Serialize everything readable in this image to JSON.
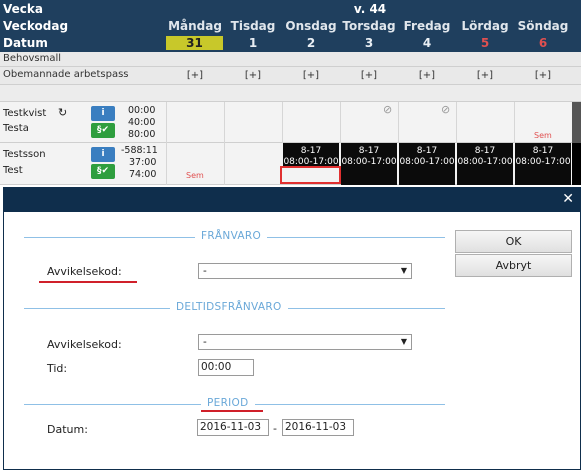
{
  "header": {
    "vecka_label": "Vecka",
    "week": "v. 44",
    "veckodag_label": "Veckodag",
    "datum_label": "Datum",
    "days": [
      {
        "name": "Måndag",
        "num": "31"
      },
      {
        "name": "Tisdag",
        "num": "1"
      },
      {
        "name": "Onsdag",
        "num": "2"
      },
      {
        "name": "Torsdag",
        "num": "3"
      },
      {
        "name": "Fredag",
        "num": "4"
      },
      {
        "name": "Lördag",
        "num": "5"
      },
      {
        "name": "Söndag",
        "num": "6"
      }
    ]
  },
  "rows": {
    "behovsmall": "Behovsmall",
    "obemannade": "Obemannade arbetspass",
    "plus": "[+]"
  },
  "employees": [
    {
      "name1": "Testkvist",
      "name2": "Testa",
      "hrs": [
        "00:00",
        "40:00",
        "80:00"
      ],
      "info": "i",
      "para": "§✔"
    },
    {
      "name1": "Testsson",
      "name2": "Test",
      "hrs": [
        "-588:11",
        "37:00",
        "74:00"
      ],
      "info": "i",
      "para": "§✔"
    }
  ],
  "shift": {
    "line1": "8-17",
    "line2": "08:00-17:00"
  },
  "sem": "Sem",
  "dialog": {
    "franvaro_title": "FRÅNVARO",
    "avvikelsekod_label": "Avvikelsekod:",
    "avvikelsekod_value": "-",
    "deltid_title": "DELTIDSFRÅNVARO",
    "deltid_avvikelsekod_label": "Avvikelsekod:",
    "deltid_avvikelsekod_value": "-",
    "tid_label": "Tid:",
    "tid_value": "00:00",
    "period_title": "PERIOD",
    "datum_label": "Datum:",
    "from_date": "2016-11-03",
    "dash": "-",
    "to_date": "2016-11-03",
    "ok_label": "OK",
    "cancel_label": "Avbryt",
    "close": "✕"
  },
  "colors": {
    "header_bg": "#1f3f5e",
    "dialog_bar": "#0f2e4c",
    "accent_underline": "#d0202a",
    "section_title": "#6aa8d8"
  }
}
